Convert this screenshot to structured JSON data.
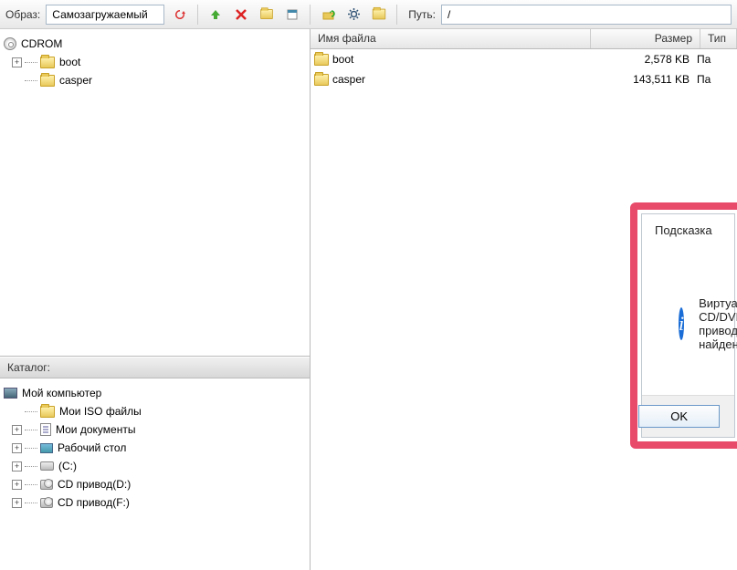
{
  "toolbar": {
    "image_label": "Образ:",
    "image_value": "Самозагружаемый",
    "path_label": "Путь:",
    "path_value": "/"
  },
  "image_tree": {
    "root": "CDROM",
    "items": [
      "boot",
      "casper"
    ]
  },
  "catalog": {
    "header": "Каталог:",
    "root": "Мой компьютер",
    "items": [
      "Мои ISO файлы",
      "Мои документы",
      "Рабочий стол",
      "(C:)",
      "CD привод(D:)",
      "CD привод(F:)"
    ]
  },
  "file_list": {
    "columns": {
      "name": "Имя файла",
      "size": "Размер",
      "type": "Тип"
    },
    "rows": [
      {
        "name": "boot",
        "size": "2,578 KB",
        "type": "Па"
      },
      {
        "name": "casper",
        "size": "143,511 KB",
        "type": "Па"
      }
    ]
  },
  "dialog": {
    "title": "Подсказка",
    "message": "Виртуальный CD/DVD привод не найден!",
    "ok": "OK"
  }
}
